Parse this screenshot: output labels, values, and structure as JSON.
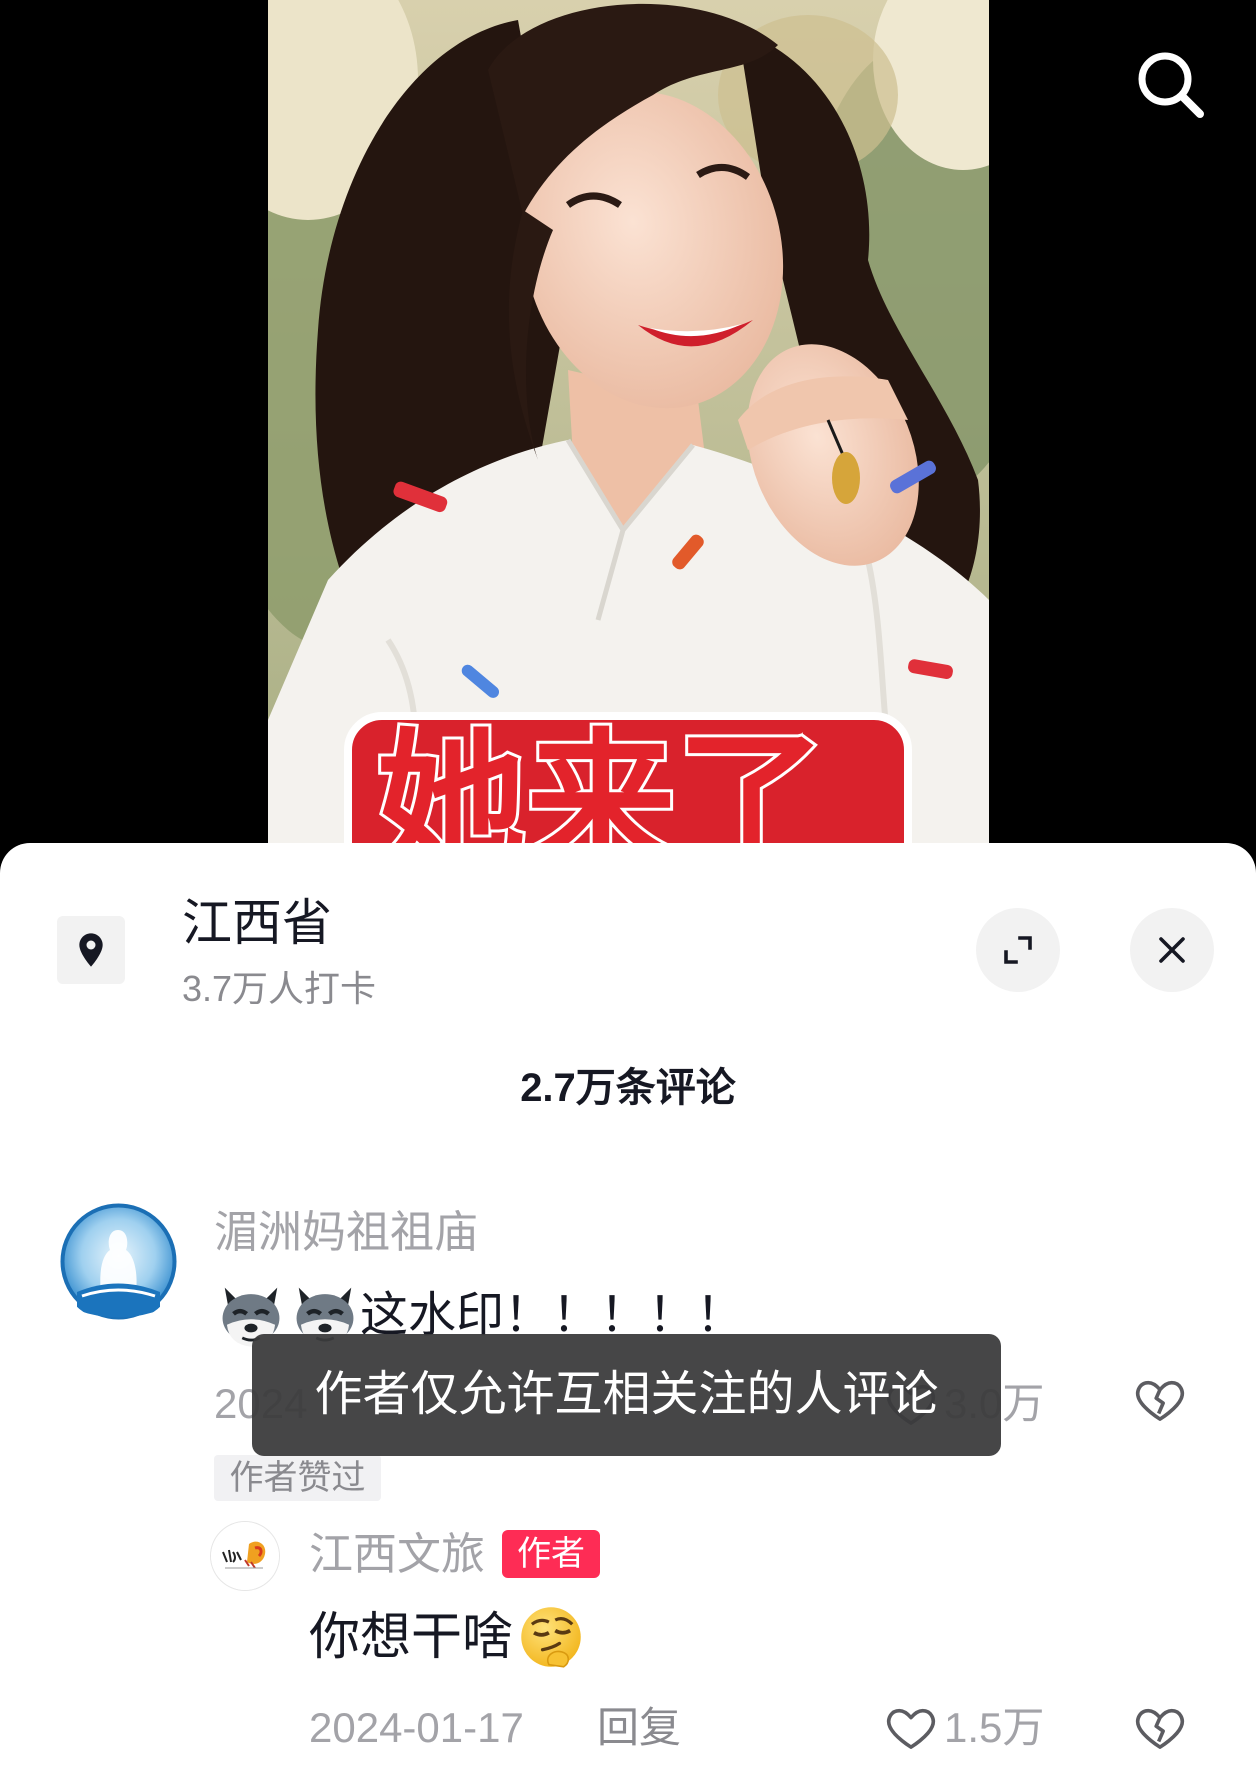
{
  "video": {
    "overlay_text": "她来了"
  },
  "top_bar": {
    "search_icon": "search-icon"
  },
  "location": {
    "icon": "location-pin-icon",
    "name": "江西省",
    "checkins": "3.7万人打卡"
  },
  "sheet_actions": {
    "expand_icon": "expand-icon",
    "close_icon": "close-icon"
  },
  "comments_header": {
    "count_label": "2.7万条评论"
  },
  "comments": [
    {
      "username": "湄洲妈祖祖庙",
      "emojis": [
        "wolf-face-emoji",
        "wolf-face-emoji"
      ],
      "text": "这水印！！！！！",
      "date": "2024",
      "likes": "3.0万",
      "like_icon": "heart-outline-icon",
      "dislike_icon": "broken-heart-icon",
      "author_liked_tag": "作者赞过",
      "replies": [
        {
          "username": "江西文旅",
          "badge": "作者",
          "text": "你想干啥",
          "emoji": "smirk-face-emoji",
          "date": "2024-01-17",
          "reply_label": "回复",
          "likes": "1.5万",
          "like_icon": "heart-outline-icon",
          "dislike_icon": "broken-heart-icon"
        }
      ]
    }
  ],
  "toast": {
    "message": "作者仅允许互相关注的人评论"
  },
  "colors": {
    "badge_red": "#fe2c55",
    "toast_bg": "rgba(58,58,60,0.94)",
    "sheet_bg": "#ffffff",
    "muted_text": "#a3a3a8",
    "primary_text": "#161823"
  }
}
